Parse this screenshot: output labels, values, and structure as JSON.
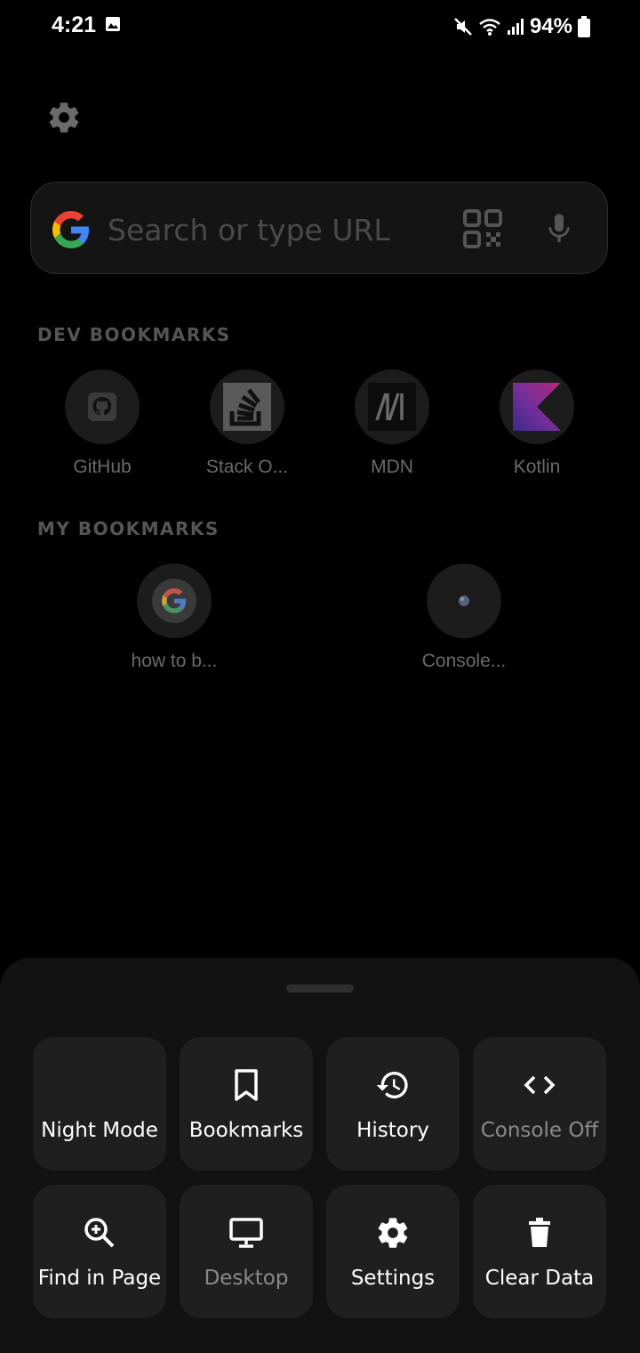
{
  "status_bar": {
    "time": "4:21",
    "battery": "94%"
  },
  "search": {
    "placeholder": "Search or type URL"
  },
  "dev_bookmarks": {
    "title": "DEV BOOKMARKS",
    "items": [
      {
        "label": "GitHub",
        "icon": "github-icon"
      },
      {
        "label": "Stack O...",
        "icon": "stackoverflow-icon"
      },
      {
        "label": "MDN",
        "icon": "mdn-icon"
      },
      {
        "label": "Kotlin",
        "icon": "kotlin-icon"
      }
    ]
  },
  "my_bookmarks": {
    "title": "MY BOOKMARKS",
    "items": [
      {
        "label": "how to b...",
        "icon": "google-icon"
      },
      {
        "label": "Console...",
        "icon": "globe-icon"
      }
    ]
  },
  "menu": {
    "tiles": [
      {
        "label": "Night Mode",
        "icon": "moon-icon"
      },
      {
        "label": "Bookmarks",
        "icon": "bookmark-icon"
      },
      {
        "label": "History",
        "icon": "history-icon"
      },
      {
        "label": "Console Off",
        "icon": "code-icon",
        "dimmed": true
      },
      {
        "label": "Find in Page",
        "icon": "zoom-in-icon"
      },
      {
        "label": "Desktop",
        "icon": "monitor-icon",
        "dimmed": true
      },
      {
        "label": "Settings",
        "icon": "gear-icon"
      },
      {
        "label": "Clear Data",
        "icon": "trash-icon"
      }
    ]
  },
  "colors": {
    "background": "#000000",
    "sheet": "#121212",
    "tile": "#1f1f1f",
    "text_primary": "#ffffff",
    "text_dim": "#8a8a8a"
  }
}
